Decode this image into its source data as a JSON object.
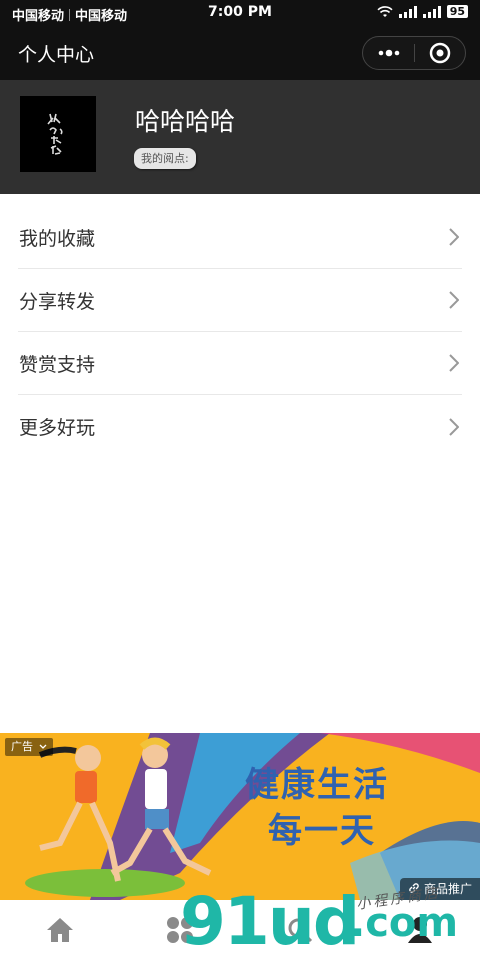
{
  "status_bar": {
    "carrier1": "中国移动",
    "carrier2": "中国移动",
    "time": "7:00 PM",
    "battery": "95"
  },
  "nav": {
    "title": "个人中心"
  },
  "profile": {
    "name": "哈哈哈哈",
    "tag": "我的阅点:",
    "avatar_text": "从心記活"
  },
  "menu": {
    "items": [
      {
        "label": "我的收藏"
      },
      {
        "label": "分享转发"
      },
      {
        "label": "赞赏支持"
      },
      {
        "label": "更多好玩"
      }
    ]
  },
  "ad": {
    "tag": "广告",
    "headline1": "健康生活",
    "headline2": "每一天",
    "promo": "商品推广"
  },
  "tab_bar": {
    "tabs": [
      {
        "icon": "home-icon"
      },
      {
        "icon": "apps-icon"
      },
      {
        "icon": "search-icon"
      },
      {
        "icon": "profile-icon"
      }
    ]
  },
  "watermark": {
    "brand": "91ud",
    "domain": ".com",
    "script": "小程序商店"
  },
  "colors": {
    "bar_bg": "#111111",
    "profile_bg": "#303030",
    "ad_bg": "#f9b21f",
    "watermark": "#1fb7a7",
    "ad_headline": "#2f62b0"
  }
}
